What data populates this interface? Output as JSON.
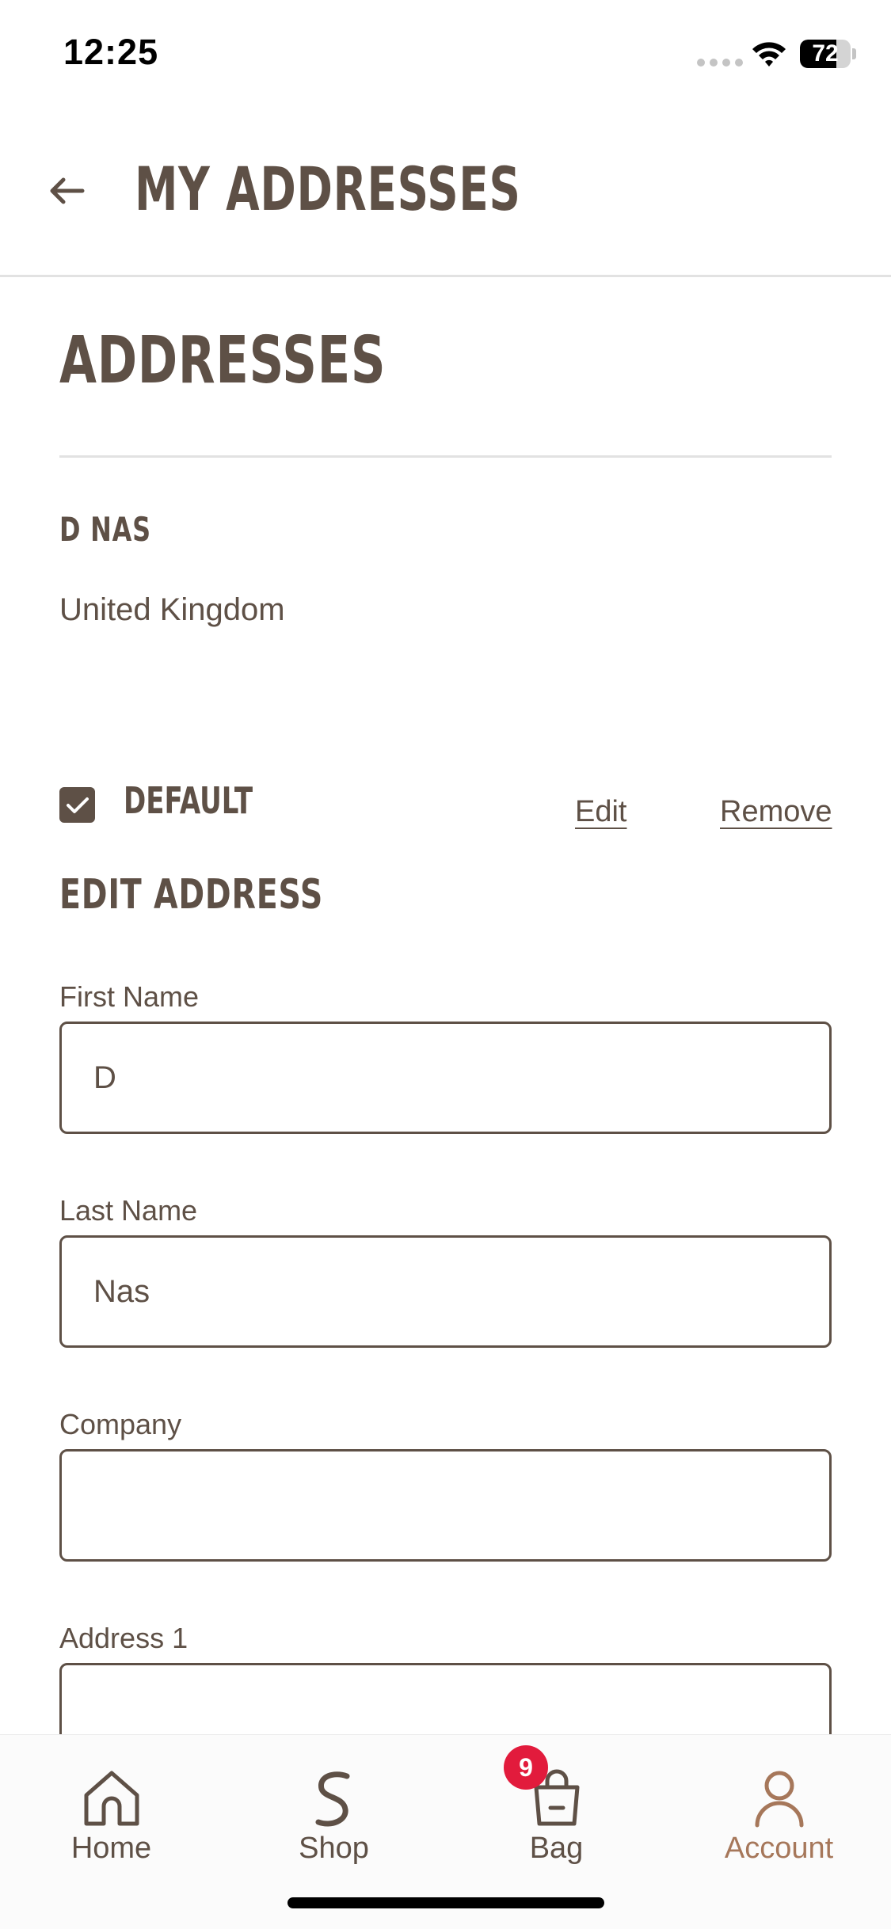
{
  "status_bar": {
    "time": "12:25",
    "battery_level": "72",
    "battery_fraction": 0.72
  },
  "header": {
    "back_icon": "arrow-left-icon",
    "title": "MY ADDRESSES"
  },
  "addresses_section": {
    "title": "ADDRESSES",
    "address": {
      "name": "D NAS",
      "country": "United Kingdom",
      "default_label": "DEFAULT",
      "default_checked": true,
      "edit_label": "Edit",
      "remove_label": "Remove"
    }
  },
  "edit_form": {
    "title": "EDIT ADDRESS",
    "fields": [
      {
        "label": "First Name",
        "value": "D"
      },
      {
        "label": "Last Name",
        "value": "Nas"
      },
      {
        "label": "Company",
        "value": ""
      },
      {
        "label": "Address 1",
        "value": ""
      }
    ]
  },
  "tab_bar": {
    "tabs": [
      {
        "label": "Home",
        "icon": "home-icon"
      },
      {
        "label": "Shop",
        "icon": "shop-logo-icon"
      },
      {
        "label": "Bag",
        "icon": "bag-icon"
      },
      {
        "label": "Account",
        "icon": "account-icon"
      }
    ],
    "bag_count": "9",
    "active_tab": "Account"
  },
  "colors": {
    "text": "#5e5046",
    "accent": "#a6775a",
    "badge": "#e21b3c",
    "divider": "#e2e2e2"
  }
}
